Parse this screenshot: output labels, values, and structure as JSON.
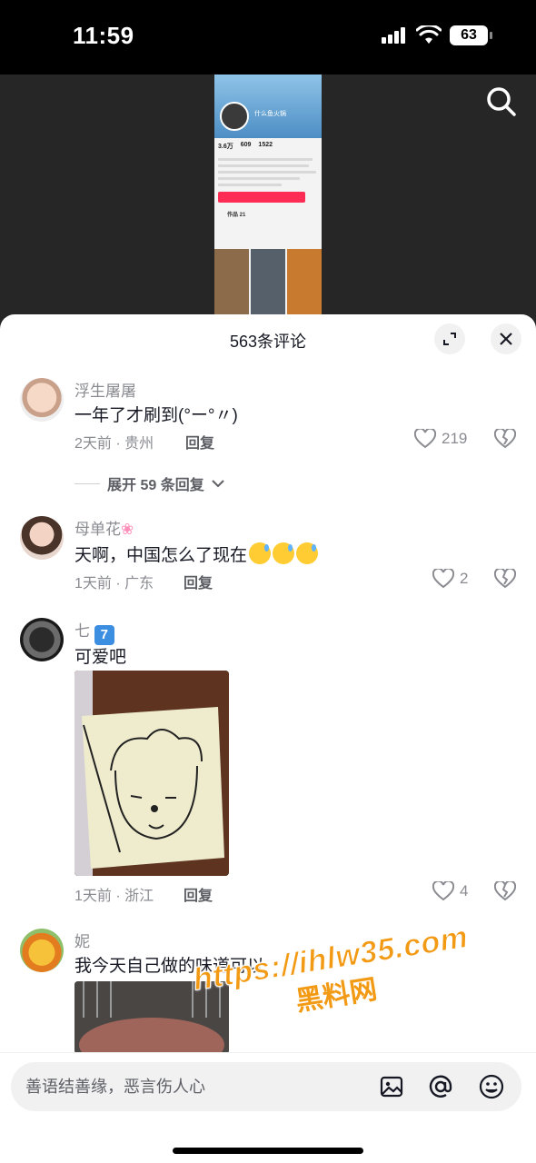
{
  "status_bar": {
    "time": "11:59",
    "battery": "63"
  },
  "video_preview": {
    "profile_name": "什么鱼火锅",
    "stats": [
      "3.6万",
      "609",
      "1522"
    ],
    "posts_label": "作品 21"
  },
  "comments_sheet": {
    "title": "563条评论",
    "comments": [
      {
        "username": "浮生屠屠",
        "text": "一年了才刷到(°ー°〃)",
        "time": "2天前",
        "location": "贵州",
        "reply_label": "回复",
        "likes": "219",
        "expand_replies": "展开 59 条回复"
      },
      {
        "username": "母单花",
        "text": "天啊，中国怎么了现在",
        "time": "1天前",
        "location": "广东",
        "reply_label": "回复",
        "likes": "2"
      },
      {
        "username": "七",
        "text": "可爱吧",
        "time": "1天前",
        "location": "浙江",
        "reply_label": "回复",
        "likes": "4"
      },
      {
        "username": "妮",
        "text": "我今天自己做的味道可以"
      }
    ]
  },
  "watermark": {
    "url": "https://ihlw35.com",
    "name": "黑料网"
  },
  "input_bar": {
    "placeholder": "善语结善缘，恶言伤人心"
  },
  "colors": {
    "accent": "#fe2c55",
    "watermark": "#f39a15",
    "muted": "#8a8b91"
  }
}
